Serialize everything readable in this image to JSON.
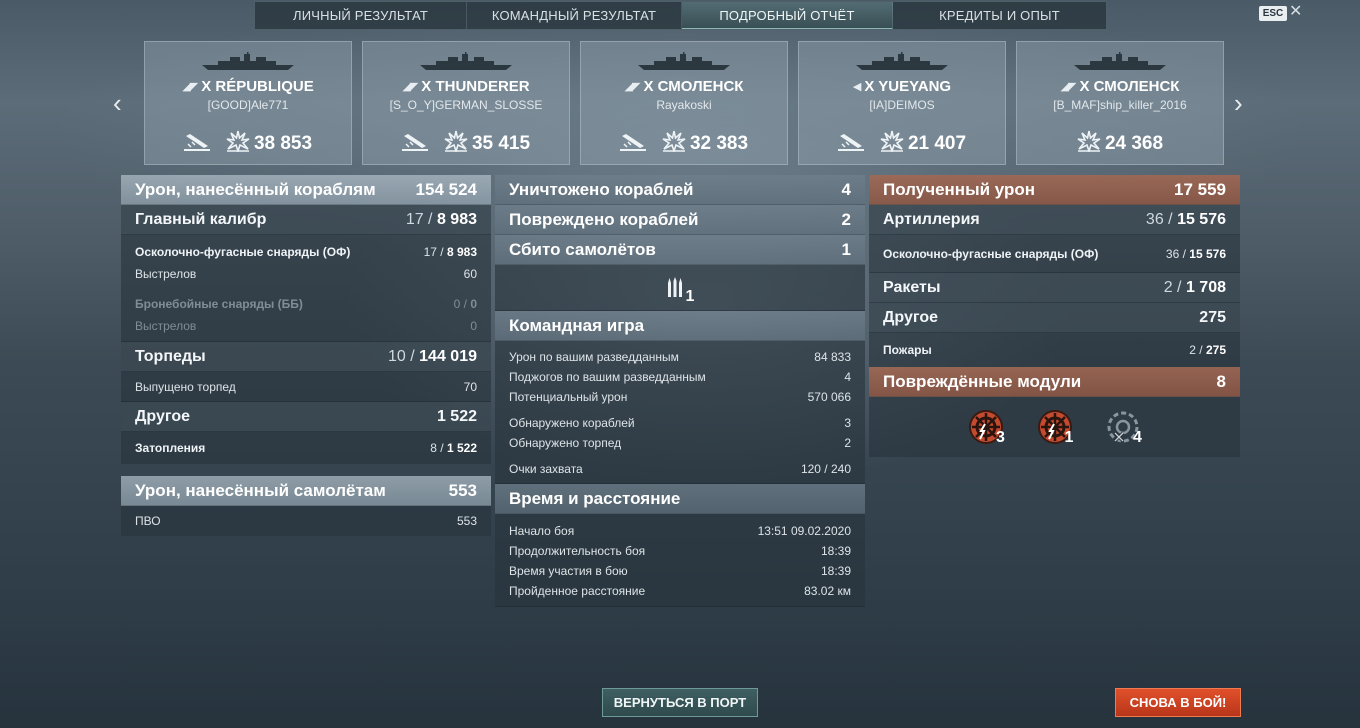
{
  "tabs": [
    {
      "label": "ЛИЧНЫЙ РЕЗУЛЬТАТ",
      "active": false
    },
    {
      "label": "КОМАНДНЫЙ РЕЗУЛЬТАТ",
      "active": false
    },
    {
      "label": "ПОДРОБНЫЙ ОТЧЁТ",
      "active": true
    },
    {
      "label": "КРЕДИТЫ И ОПЫТ",
      "active": false
    }
  ],
  "esc_label": "ESC",
  "close_glyph": "✕",
  "nav": {
    "prev": "‹",
    "next": "›"
  },
  "cards": [
    {
      "tier": "X",
      "ship": "RÉPUBLIQUE",
      "player": "[GOOD]Ale771",
      "damage": "38 853",
      "icon": "battleship-icon",
      "show_kill_icon": true
    },
    {
      "tier": "X",
      "ship": "THUNDERER",
      "player": "[S_O_Y]GERMAN_SLOSSE",
      "damage": "35 415",
      "icon": "battleship-icon",
      "show_kill_icon": true
    },
    {
      "tier": "X",
      "ship": "СМОЛЕНСК",
      "player": "Rayakoski",
      "damage": "32 383",
      "icon": "cruiser-icon",
      "show_kill_icon": true
    },
    {
      "tier": "X",
      "ship": "YUEYANG",
      "player": "[IA]DEIMOS",
      "damage": "21 407",
      "icon": "destroyer-icon",
      "show_kill_icon": true
    },
    {
      "tier": "X",
      "ship": "СМОЛЕНСК",
      "player": "[B_MAF]ship_killer_2016",
      "damage": "24 368",
      "icon": "cruiser-icon",
      "show_kill_icon": false
    }
  ],
  "left": {
    "ship_damage": {
      "label": "Урон, нанесённый кораблям",
      "value": "154 524"
    },
    "main_battery": {
      "label": "Главный калибр",
      "hits": "17",
      "damage": "8 983"
    },
    "he": {
      "label": "Осколочно-фугасные снаряды (ОФ)",
      "hits": "17",
      "damage": "8 983"
    },
    "he_shots": {
      "label": "Выстрелов",
      "value": "60"
    },
    "ap": {
      "label": "Бронебойные снаряды (ББ)",
      "hits": "0",
      "damage": "0"
    },
    "ap_shots": {
      "label": "Выстрелов",
      "value": "0"
    },
    "torpedoes": {
      "label": "Торпеды",
      "hits": "10",
      "damage": "144 019"
    },
    "torp_launched": {
      "label": "Выпущено торпед",
      "value": "70"
    },
    "other": {
      "label": "Другое",
      "value": "1 522"
    },
    "flooding": {
      "label": "Затопления",
      "hits": "8",
      "damage": "1 522"
    },
    "plane_damage": {
      "label": "Урон, нанесённый самолётам",
      "value": "553"
    },
    "aa": {
      "label": "ПВО",
      "value": "553"
    }
  },
  "middle": {
    "destroyed": {
      "label": "Уничтожено кораблей",
      "value": "4"
    },
    "damaged": {
      "label": "Повреждено кораблей",
      "value": "2"
    },
    "planes_shot": {
      "label": "Сбито самолётов",
      "value": "1"
    },
    "ribbon_count": "1",
    "team_play": {
      "title": "Командная игра",
      "rows": [
        {
          "label": "Урон по вашим разведданным",
          "value": "84 833"
        },
        {
          "label": "Поджогов по вашим разведданным",
          "value": "4"
        },
        {
          "label": "Потенциальный урон",
          "value": "570 066"
        }
      ],
      "rows2": [
        {
          "label": "Обнаружено кораблей",
          "value": "3"
        },
        {
          "label": "Обнаружено торпед",
          "value": "2"
        }
      ],
      "rows3": [
        {
          "label": "Очки захвата",
          "value": "120 / 240"
        }
      ]
    },
    "time": {
      "title": "Время и расстояние",
      "rows": [
        {
          "label": "Начало боя",
          "value": "13:51  09.02.2020"
        },
        {
          "label": "Продолжительность боя",
          "value": "18:39"
        },
        {
          "label": "Время участия в бою",
          "value": "18:39"
        },
        {
          "label": "Пройденное расстояние",
          "value": "83.02 км"
        }
      ]
    }
  },
  "right": {
    "received": {
      "label": "Полученный урон",
      "value": "17 559"
    },
    "artillery": {
      "label": "Артиллерия",
      "hits": "36",
      "damage": "15 576"
    },
    "he": {
      "label": "Осколочно-фугасные снаряды (ОФ)",
      "hits": "36",
      "damage": "15 576"
    },
    "rockets": {
      "label": "Ракеты",
      "hits": "2",
      "damage": "1 708"
    },
    "other": {
      "label": "Другое",
      "value": "275"
    },
    "fires": {
      "label": "Пожары",
      "hits": "2",
      "damage": "275"
    },
    "modules": {
      "label": "Повреждённые модули",
      "value": "8"
    },
    "module_counts": [
      {
        "icon": "steering-gear-icon",
        "count": "3"
      },
      {
        "icon": "steering-gear-icon",
        "count": "1"
      },
      {
        "icon": "engine-disabled-icon",
        "count": "4"
      }
    ]
  },
  "buttons": {
    "port": "ВЕРНУТЬСЯ В ПОРТ",
    "battle": "СНОВА В БОЙ!"
  },
  "colors": {
    "orange_header": "#9c5e46",
    "battle_button": "#d3461f",
    "active_tab": "#4e6f74"
  }
}
